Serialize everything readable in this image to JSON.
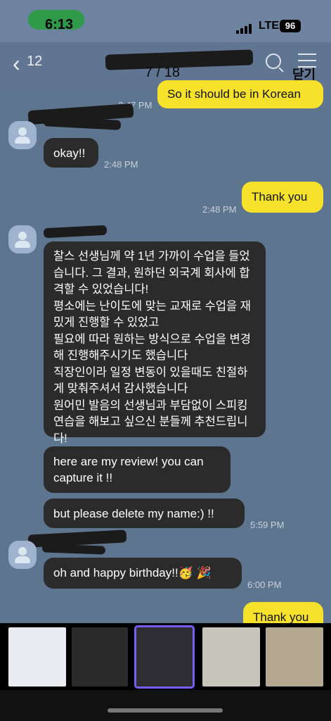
{
  "status": {
    "time": "6:13",
    "network": "LTE",
    "battery": "96"
  },
  "header": {
    "back_count": "12",
    "pager": "7 / 18",
    "close": "닫기"
  },
  "messages": {
    "m1": "So it should be in Korean",
    "t1": "2:47 PM",
    "m2": "okay!!",
    "t2": "2:48 PM",
    "m3": "Thank you",
    "t3": "2:48 PM",
    "m4": "찰스 선생님께 약 1년 가까이 수업을 들었습니다. 그 결과, 원하던 외국계 회사에 합격할 수 있었습니다!\n평소에는 난이도에 맞는 교재로 수업을 재밌게 진행할 수 있었고\n필요에 따라 원하는 방식으로 수업을 변경해 진행해주시기도 했습니다\n직장인이라 일정 변동이 있을때도 친절하게 맞춰주셔서 감사했습니다\n원어민 발음의 선생님과 부담없이 스피킹 연습을 해보고 싶으신 분들께 추천드립니다!",
    "m5": "here are my review! you can capture it !!",
    "m6": "but please delete my name:) !!",
    "t6": "5:59 PM",
    "m7": "oh and happy birthday!!🥳 🎉",
    "t7": "6:00 PM",
    "m8": "Thank you"
  },
  "colors": {
    "chat_bg": "#5e7590",
    "outgoing": "#f6e12b",
    "incoming": "#2b2b2b"
  }
}
